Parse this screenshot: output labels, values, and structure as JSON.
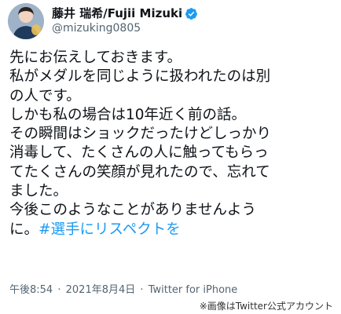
{
  "user": {
    "display_name": "藤井 瑞希/Fujii Mizuki",
    "handle": "@mizuking0805",
    "verified": true
  },
  "tweet": {
    "lines": [
      "先にお伝えしておきます。",
      "私がメダルを同じように扱われたのは別",
      "の人です。",
      "しかも私の場合は10年近く前の話。",
      "その瞬間はショックだったけどしっかり",
      "消毒して、たくさんの人に触ってもらっ",
      "てたくさんの笑顔が見れたので、忘れて",
      "ました。",
      "今後このようなことがありませんよう"
    ],
    "last_line_prefix": "に。",
    "hashtag": "#選手にリスペクトを"
  },
  "meta": {
    "time": "午後8:54",
    "separator": "·",
    "date": "2021年8月4日",
    "source": "Twitter for iPhone"
  },
  "credit": "※画像はTwitter公式アカウント",
  "colors": {
    "hashtag": "#1d9bf0",
    "verified": "#1d9bf0",
    "secondary_text": "#536471"
  },
  "icons": {
    "avatar": "avatar-photo",
    "verified": "verified-badge-icon"
  }
}
